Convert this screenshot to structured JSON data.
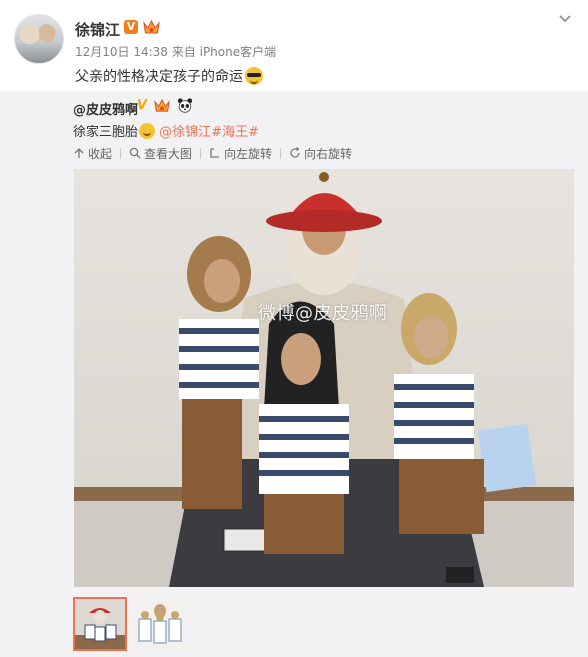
{
  "post": {
    "author": "徐锦江",
    "time": "12月10日 14:38",
    "from_label": "来自",
    "source": "iPhone客户端",
    "text": "父亲的性格决定孩子的命运"
  },
  "repost": {
    "author": "@皮皮鸦啊",
    "text_prefix": "徐家三胞胎",
    "mention": "@徐锦江",
    "hashtag": "#海王#",
    "actions": {
      "collect": "收起",
      "view_large": "查看大图",
      "rotate_left": "向左旋转",
      "rotate_right": "向右旋转"
    },
    "watermark": "微博@皮皮鸦啊",
    "thumbnail_count": 2,
    "active_thumbnail": 1
  },
  "colors": {
    "link": "#eb7350",
    "verified_badge": "#f57c1b",
    "repost_bg": "#f2f2f5"
  },
  "icons": [
    "v-verified-icon",
    "crown-icon",
    "chevron-down-icon",
    "panda-icon",
    "collapse-icon",
    "search-icon",
    "rotate-left-icon",
    "rotate-right-icon"
  ]
}
